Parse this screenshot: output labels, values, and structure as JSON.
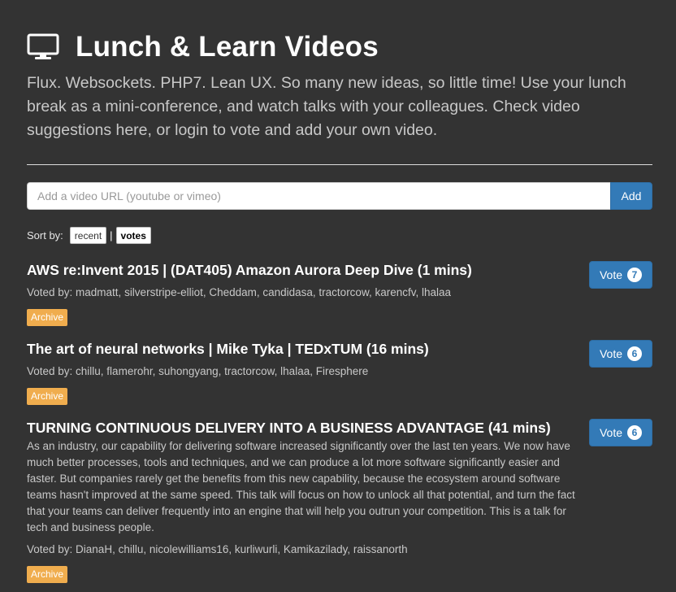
{
  "header": {
    "title": "Lunch & Learn Videos",
    "icon": "monitor-icon",
    "intro": "Flux. Websockets. PHP7. Lean UX. So many new ideas, so little time! Use your lunch break as a mini-conference, and watch talks with your colleagues. Check video suggestions here, or login to vote and add your own video."
  },
  "add_form": {
    "placeholder": "Add a video URL (youtube or vimeo)",
    "button_label": "Add"
  },
  "sort": {
    "label": "Sort by:",
    "options": [
      "recent",
      "votes"
    ],
    "separator": "|",
    "active": "votes"
  },
  "colors": {
    "background": "#333333",
    "primary": "#337ab7",
    "archive": "#f0ad4e"
  },
  "videos": [
    {
      "title": "AWS re:Invent 2015 | (DAT405) Amazon Aurora Deep Dive (1 mins)",
      "description": "",
      "voted_by": "Voted by: madmatt, silverstripe-elliot, Cheddam, candidasa, tractorcow, karencfv, lhalaa",
      "tag": "Archive",
      "vote_label": "Vote",
      "votes": "7"
    },
    {
      "title": "The art of neural networks | Mike Tyka | TEDxTUM (16 mins)",
      "description": "",
      "voted_by": "Voted by: chillu, flamerohr, suhongyang, tractorcow, lhalaa, Firesphere",
      "tag": "Archive",
      "vote_label": "Vote",
      "votes": "6"
    },
    {
      "title": "TURNING CONTINUOUS DELIVERY INTO A BUSINESS ADVANTAGE (41 mins)",
      "description": "As an industry, our capability for delivering software increased significantly over the last ten years. We now have much better processes, tools and techniques, and we can produce a lot more software significantly easier and faster. But companies rarely get the benefits from this new capability, because the ecosystem around software teams hasn't improved at the same speed. This talk will focus on how to unlock all that potential, and turn the fact that your teams can deliver frequently into an engine that will help you outrun your competition. This is a talk for tech and business people.",
      "voted_by": "Voted by: DianaH, chillu, nicolewilliams16, kurliwurli, Kamikazilady, raissanorth",
      "tag": "Archive",
      "vote_label": "Vote",
      "votes": "6"
    }
  ]
}
